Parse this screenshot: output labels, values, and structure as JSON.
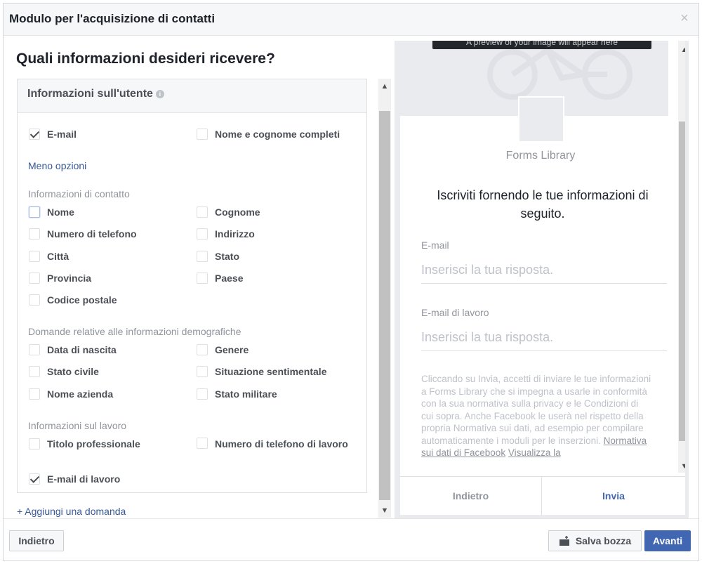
{
  "dialog": {
    "title": "Modulo per l'acquisizione di contatti",
    "close_glyph": "×"
  },
  "left": {
    "heading": "Quali informazioni desideri ricevere?",
    "card_title": "Informazioni sull'utente",
    "info_glyph": "i",
    "top_options": [
      {
        "label": "E-mail",
        "checked": true
      },
      {
        "label": "Nome e cognome completi",
        "checked": false
      }
    ],
    "less_options": "Meno opzioni",
    "sections": [
      {
        "title": "Informazioni di contatto",
        "options": [
          {
            "label": "Nome",
            "checked": false
          },
          {
            "label": "Cognome",
            "checked": false
          },
          {
            "label": "Numero di telefono",
            "checked": false
          },
          {
            "label": "Indirizzo",
            "checked": false
          },
          {
            "label": "Città",
            "checked": false
          },
          {
            "label": "Stato",
            "checked": false
          },
          {
            "label": "Provincia",
            "checked": false
          },
          {
            "label": "Paese",
            "checked": false
          },
          {
            "label": "Codice postale",
            "checked": false
          }
        ]
      },
      {
        "title": "Domande relative alle informazioni demografiche",
        "options": [
          {
            "label": "Data di nascita",
            "checked": false
          },
          {
            "label": "Genere",
            "checked": false
          },
          {
            "label": "Stato civile",
            "checked": false
          },
          {
            "label": "Situazione sentimentale",
            "checked": false
          },
          {
            "label": "Nome azienda",
            "checked": false
          },
          {
            "label": "Stato militare",
            "checked": false
          }
        ]
      },
      {
        "title": "Informazioni sul lavoro",
        "options": [
          {
            "label": "Titolo professionale",
            "checked": false
          },
          {
            "label": "Numero di telefono di lavoro",
            "checked": false
          },
          {
            "label": "E-mail di lavoro",
            "checked": true
          }
        ]
      }
    ],
    "add_question": "+ Aggiungi una domanda"
  },
  "preview": {
    "cover_banner": "A preview of your image will appear here",
    "page_name": "Forms Library",
    "heading": "Iscriviti fornendo le tue informazioni di seguito.",
    "fields": [
      {
        "label": "E-mail",
        "placeholder": "Inserisci la tua risposta."
      },
      {
        "label": "E-mail di lavoro",
        "placeholder": "Inserisci la tua risposta."
      }
    ],
    "disclaimer": "Cliccando su Invia, accetti di inviare le tue informazioni a Forms Library che si impegna a usarle in conformità con la sua normativa sulla privacy e le Condizioni di cui sopra. Anche Facebook le userà nel rispetto della propria Normativa sui dati, ad esempio per compilare automaticamente i moduli per le inserzioni.",
    "policy_link": "Normativa sui dati di Facebook",
    "view_link": "Visualizza la",
    "back_label": "Indietro",
    "send_label": "Invia"
  },
  "footer": {
    "back_label": "Indietro",
    "draft_label": "Salva bozza",
    "next_label": "Avanti"
  },
  "colors": {
    "accent": "#4267b2",
    "link": "#365899",
    "muted": "#90949c"
  }
}
